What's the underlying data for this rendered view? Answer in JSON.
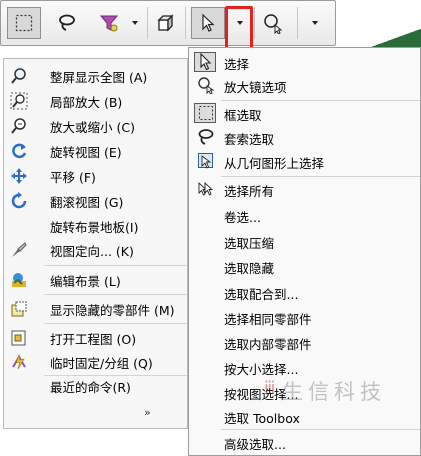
{
  "toolbar": {
    "buttons": [
      {
        "name": "box-select-button",
        "icon": "dotted-rectangle-icon",
        "pressed": true
      },
      {
        "name": "lasso-button",
        "icon": "lasso-icon"
      },
      {
        "name": "filter-button",
        "icon": "filter-icon"
      },
      {
        "name": "filter-dropdown-button",
        "icon": "chevron-down-icon"
      },
      {
        "name": "view-cube-button",
        "icon": "view-cube-icon"
      },
      {
        "name": "select-pointer-button",
        "icon": "pointer-icon",
        "pressed": true
      },
      {
        "name": "select-dropdown-button",
        "icon": "chevron-down-icon",
        "highlighted": true
      },
      {
        "name": "magnifier-select-button",
        "icon": "magnifier-select-icon"
      },
      {
        "name": "more-dropdown-button",
        "icon": "chevron-down-icon"
      }
    ],
    "highlight_color": "#e81f1f"
  },
  "left_menu": {
    "items": [
      {
        "label": "整屏显示全图 (A)",
        "icon": "zoom-to-fit-icon"
      },
      {
        "label": "局部放大 (B)",
        "icon": "zoom-area-icon"
      },
      {
        "label": "放大或缩小 (C)",
        "icon": "zoom-in-out-icon"
      },
      {
        "label": "旋转视图 (E)",
        "icon": "rotate-view-icon"
      },
      {
        "label": "平移 (F)",
        "icon": "pan-icon"
      },
      {
        "label": "翻滚视图 (G)",
        "icon": "roll-view-icon"
      },
      {
        "label": "旋转布景地板(I)",
        "icon": ""
      },
      {
        "label": "视图定向... (K)",
        "icon": "view-orientation-icon"
      },
      {
        "label": "编辑布景 (L)",
        "icon": "edit-scene-icon"
      },
      {
        "label": "显示隐藏的零部件 (M)",
        "icon": "show-hidden-components-icon"
      },
      {
        "label": "打开工程图 (O)",
        "icon": "open-drawing-icon"
      },
      {
        "label": "临时固定/分组 (Q)",
        "icon": "temp-fix-group-icon"
      },
      {
        "label": "最近的命令(R)",
        "icon": ""
      }
    ],
    "more_label": "»"
  },
  "dropdown_menu": {
    "items": [
      {
        "label": "选择",
        "icon": "pointer-icon",
        "checked": true
      },
      {
        "label": "放大镜选项",
        "icon": "magnifier-select-icon"
      },
      {
        "label": "框选取",
        "icon": "dotted-rectangle-icon",
        "checked": true
      },
      {
        "label": "套索选取",
        "icon": "lasso-icon"
      },
      {
        "label": "从几何图形上选择",
        "icon": "select-from-geometry-icon"
      },
      {
        "label": "选择所有",
        "icon": "select-all-icon"
      },
      {
        "label": "卷选...",
        "icon": ""
      },
      {
        "label": "选取压缩",
        "icon": ""
      },
      {
        "label": "选取隐藏",
        "icon": ""
      },
      {
        "label": "选取配合到...",
        "icon": ""
      },
      {
        "label": "选择相同零部件",
        "icon": ""
      },
      {
        "label": "选取内部零部件",
        "icon": ""
      },
      {
        "label": "按大小选择...",
        "icon": ""
      },
      {
        "label": "按视图选择...",
        "icon": ""
      },
      {
        "label": "选取 Toolbox",
        "icon": ""
      },
      {
        "label": "高级选取...",
        "icon": ""
      }
    ]
  },
  "watermark": {
    "text": "生信科技"
  }
}
